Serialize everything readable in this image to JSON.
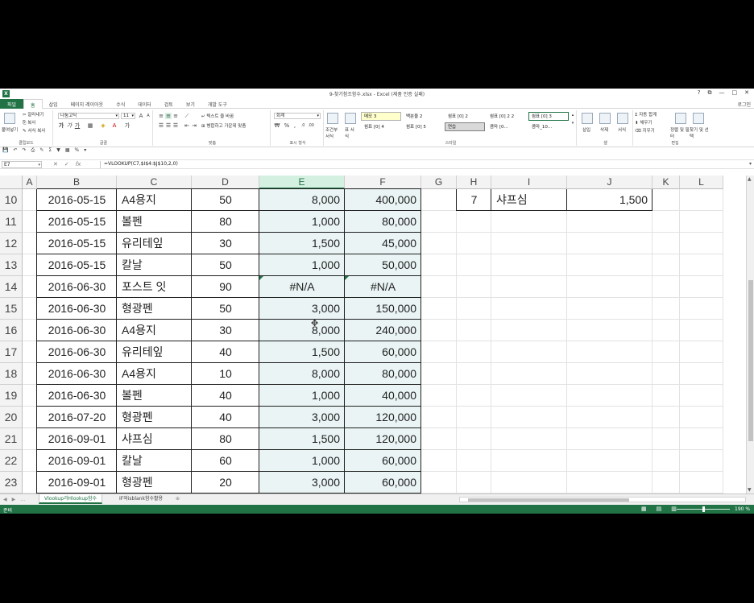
{
  "window": {
    "title": "9-찾기참조함수.xlsx - Excel (제품 인증 실패)",
    "help": "?",
    "restore": "⧉",
    "minimize": "—",
    "maximize": "□",
    "close": "✕"
  },
  "ribbon_tabs": [
    "파일",
    "홈",
    "삽입",
    "페이지 레이아웃",
    "수식",
    "데이터",
    "검토",
    "보기",
    "개발 도구"
  ],
  "login": "로그인",
  "ribbon": {
    "clipboard": {
      "label": "클립보드",
      "paste": "붙여넣기",
      "cut": "잘라내기",
      "copy": "복사",
      "format_painter": "서식 복사"
    },
    "font": {
      "label": "글꼴",
      "name": "나눔고딕",
      "size": "11",
      "bold": "가",
      "italic": "가",
      "underline": "가"
    },
    "alignment": {
      "label": "맞춤",
      "wrap": "텍스트 줄 바꿈",
      "merge": "병합하고 가운데 맞춤"
    },
    "number": {
      "label": "표시 형식",
      "format": "회계",
      "percent": "%",
      "comma": ","
    },
    "cond_format": "조건부 서식",
    "table_format": "표 서식",
    "styles": {
      "label": "스타일",
      "items": [
        "메모 3",
        "백분율 2",
        "쉼표 [0] 2",
        "쉼표 [0] 2 2",
        "쉼표 [0] 3",
        "쉼표 [0] 4",
        "쉼표 [0] 5",
        "연습",
        "콤마 [0...",
        "콤마_10..."
      ]
    },
    "cells": {
      "label": "셀",
      "insert": "삽입",
      "delete": "삭제",
      "format": "서식"
    },
    "editing": {
      "label": "편집",
      "autosum": "자동 합계",
      "fill": "채우기",
      "clear": "지우기",
      "sort": "정렬 및 필터",
      "find": "찾기 및 선택"
    }
  },
  "formula_bar": {
    "name_box": "E7",
    "cancel": "✕",
    "enter": "✓",
    "fx": "fx",
    "formula": "=VLOOKUP(C7,$I$4:$J$10,2,0)"
  },
  "columns": [
    "A",
    "B",
    "C",
    "D",
    "E",
    "F",
    "G",
    "H",
    "I",
    "J",
    "K",
    "L"
  ],
  "rows": [
    {
      "n": "10",
      "date": "2016-05-15",
      "item": "A4용지",
      "qty": "50",
      "price": "8,000",
      "amount": "400,000"
    },
    {
      "n": "11",
      "date": "2016-05-15",
      "item": "볼펜",
      "qty": "80",
      "price": "1,000",
      "amount": "80,000"
    },
    {
      "n": "12",
      "date": "2016-05-15",
      "item": "유리테잎",
      "qty": "30",
      "price": "1,500",
      "amount": "45,000"
    },
    {
      "n": "13",
      "date": "2016-05-15",
      "item": "칼날",
      "qty": "50",
      "price": "1,000",
      "amount": "50,000"
    },
    {
      "n": "14",
      "date": "2016-06-30",
      "item": "포스트 잇",
      "qty": "90",
      "price": "#N/A",
      "amount": "#N/A"
    },
    {
      "n": "15",
      "date": "2016-06-30",
      "item": "형광펜",
      "qty": "50",
      "price": "3,000",
      "amount": "150,000"
    },
    {
      "n": "16",
      "date": "2016-06-30",
      "item": "A4용지",
      "qty": "30",
      "price": "8,000",
      "amount": "240,000"
    },
    {
      "n": "17",
      "date": "2016-06-30",
      "item": "유리테잎",
      "qty": "40",
      "price": "1,500",
      "amount": "60,000"
    },
    {
      "n": "18",
      "date": "2016-06-30",
      "item": "A4용지",
      "qty": "10",
      "price": "8,000",
      "amount": "80,000"
    },
    {
      "n": "19",
      "date": "2016-06-30",
      "item": "볼펜",
      "qty": "40",
      "price": "1,000",
      "amount": "40,000"
    },
    {
      "n": "20",
      "date": "2016-07-20",
      "item": "형광펜",
      "qty": "40",
      "price": "3,000",
      "amount": "120,000"
    },
    {
      "n": "21",
      "date": "2016-09-01",
      "item": "샤프심",
      "qty": "80",
      "price": "1,500",
      "amount": "120,000"
    },
    {
      "n": "22",
      "date": "2016-09-01",
      "item": "칼날",
      "qty": "60",
      "price": "1,000",
      "amount": "60,000"
    },
    {
      "n": "23",
      "date": "2016-09-01",
      "item": "형광펜",
      "qty": "20",
      "price": "3,000",
      "amount": "60,000"
    }
  ],
  "lookup_row": {
    "no": "7",
    "name": "샤프심",
    "price": "1,500"
  },
  "sheets": [
    "Vlookup과Hlookup함수",
    "IF와isblank함수활용"
  ],
  "add_sheet": "⊕",
  "status": {
    "ready": "준비",
    "zoom": "190 %"
  }
}
